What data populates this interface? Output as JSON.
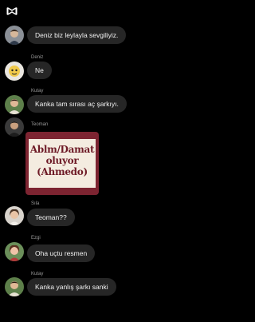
{
  "app": {
    "logo_icon": "capcut-logo-icon"
  },
  "colors": {
    "background": "#000000",
    "bubble": "#262626",
    "sender_text": "#9a9a9a",
    "media_frame": "#7d2431",
    "media_paper": "#f4ece0",
    "media_text": "#6e1b27"
  },
  "messages": [
    {
      "sender": "",
      "text": "Deniz biz leylayla sevgiliyiz."
    },
    {
      "sender": "Deniz",
      "text": "Ne"
    },
    {
      "sender": "Kutay",
      "text": "Kanka tam sırası aç şarkıyı."
    },
    {
      "sender": "Teoman",
      "media_text": [
        "Ablm/Damat",
        "oluyor",
        "(Ahmedo)"
      ]
    },
    {
      "sender": "Sıla",
      "text": "Teoman??"
    },
    {
      "sender": "Ezgi",
      "text": "Oha uçtu resmen"
    },
    {
      "sender": "Kutay",
      "text": "Kanka yanlış şarkı sanki"
    }
  ]
}
